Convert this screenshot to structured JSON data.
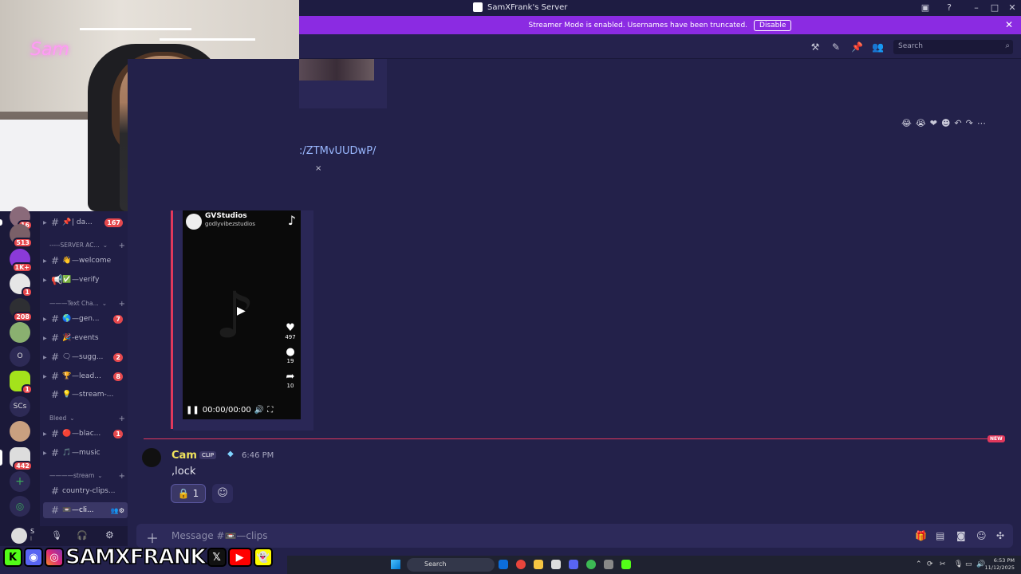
{
  "window": {
    "title": "SamXFrank's Server"
  },
  "banner": {
    "text": "Streamer Mode is enabled. Usernames have been truncated.",
    "button": "Disable"
  },
  "header": {
    "search_placeholder": "Search"
  },
  "webcam": {
    "neon_text": "Sam"
  },
  "guilds": [
    {
      "badge": "16"
    },
    {
      "badge": "513"
    },
    {
      "badge": "1K+"
    },
    {
      "badge": "1"
    },
    {
      "badge": "208"
    },
    {
      "badge": ""
    },
    {
      "text": "O"
    },
    {
      "badge": "1"
    },
    {
      "text": "SCs"
    },
    {
      "badge": ""
    },
    {
      "badge": "442"
    }
  ],
  "channels": {
    "items": [
      {
        "emoji": "📌",
        "name": "| da...",
        "count": "167"
      },
      {
        "category": "-----SERVER AC..."
      },
      {
        "emoji": "👋",
        "name": "—welcome"
      },
      {
        "emoji": "✅",
        "name": "—verify"
      },
      {
        "category": "———Text Cha..."
      },
      {
        "emoji": "🌎",
        "name": "—gen...",
        "count": "7"
      },
      {
        "emoji": "🎉",
        "name": "-events"
      },
      {
        "emoji": "🗨",
        "name": "—sugg...",
        "count": "2"
      },
      {
        "emoji": "🏆",
        "name": "—lead...",
        "count": "8"
      },
      {
        "emoji": "💡",
        "name": "—stream-..."
      },
      {
        "category": "Bleed"
      },
      {
        "emoji": "🔴",
        "name": "—blac...",
        "count": "1"
      },
      {
        "emoji": "🎵",
        "name": "—music"
      },
      {
        "category": "————stream"
      },
      {
        "emoji": "",
        "name": "country-clips..."
      },
      {
        "emoji": "📼",
        "name": "—cli..."
      }
    ]
  },
  "user": {
    "name": "S",
    "sub": "l"
  },
  "preview": {
    "link": ":/ZTMvUUDwP/",
    "close": "×"
  },
  "embed": {
    "author": "GVStudios",
    "handle": "godlyvibezstudios",
    "likes": "497",
    "comments": "19",
    "shares": "10",
    "time": "00:00/00:00"
  },
  "message": {
    "author": "Cam",
    "tag": "CLIP",
    "time": "6:46 PM",
    "text": ",lock",
    "reaction_emoji": "🔒",
    "reaction_count": "1",
    "new_label": "NEW"
  },
  "composer": {
    "placeholder": "Message #📼—clips"
  },
  "overlay": {
    "brand": "SAMXFRANK"
  },
  "taskbar": {
    "search": "Search",
    "time": "6:53 PM",
    "date": "11/12/2025"
  },
  "colors": {
    "accent": "#8b2be2",
    "new_line": "#e2385c",
    "author": "#f0e35c"
  }
}
